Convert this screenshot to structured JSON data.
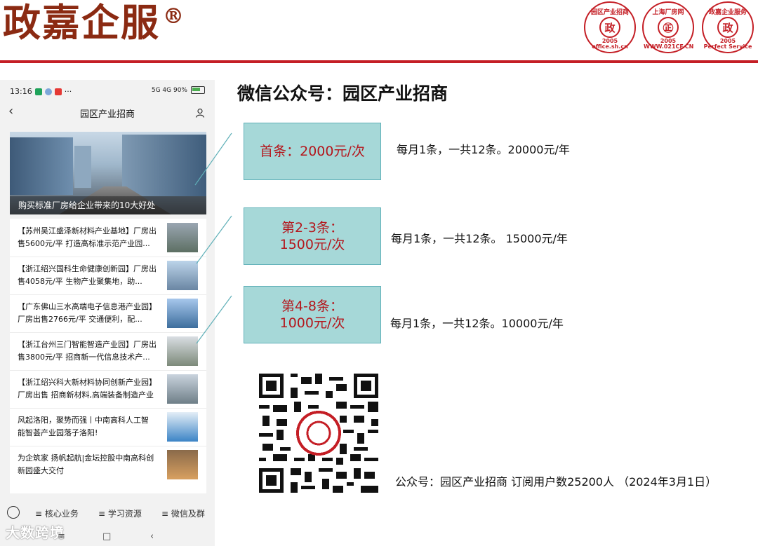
{
  "header": {
    "brand": "政嘉企服",
    "registered": "®",
    "seals": [
      {
        "center": "政",
        "top": "园区产业招商",
        "year": "2005",
        "bottom": "office.sh.cn"
      },
      {
        "center": "㊣",
        "top": "上海厂房网",
        "year": "2005",
        "bottom": "WWW.021CF.CN"
      },
      {
        "center": "政",
        "top": "政嘉企业服务",
        "year": "2005",
        "bottom": "Perfect Service"
      }
    ]
  },
  "phone": {
    "time": "13:16",
    "status_right": "5G 4G 90%",
    "nav_title": "园区产业招商",
    "hero_caption": "购买标准厂房给企业带来的10大好处",
    "articles": [
      {
        "line1": "【苏州吴江盛泽新材料产业基地】厂房出",
        "line2": "售5600元/平 打造高标准示范产业园..."
      },
      {
        "line1": "【浙江绍兴国科生命健康创新园】厂房出",
        "line2": "售4058元/平 生物产业聚集地，助..."
      },
      {
        "line1": "【广东佛山三水高端电子信息港产业园】",
        "line2": "厂房出售2766元/平 交通便利，配..."
      },
      {
        "line1": "【浙江台州三门智能智造产业园】厂房出",
        "line2": "售3800元/平 招商新一代信息技术产..."
      },
      {
        "line1": "【浙江绍兴科大新材料协同创新产业园】",
        "line2": "厂房出售 招商新材料,高端装备制造产业"
      },
      {
        "line1": "风起洛阳，聚势而强丨中南高科人工智",
        "line2": "能智荟产业园落子洛阳!"
      },
      {
        "line1": "为企筑家 扬帆起航|金坛控股中南高科创",
        "line2": "新园盛大交付"
      }
    ],
    "tabs": [
      "核心业务",
      "学习资源",
      "微信及群"
    ],
    "watermark": "大数跨境"
  },
  "panel": {
    "title": "微信公众号：园区产业招商",
    "prices": [
      {
        "label": "首条：2000元/次",
        "note": "每月1条，一共12条。20000元/年"
      },
      {
        "label_line1": "第2-3条：",
        "label_line2": "1500元/次",
        "note": "每月1条，一共12条。 15000元/年"
      },
      {
        "label_line1": "第4-8条：",
        "label_line2": "1000元/次",
        "note": "每月1条，一共12条。10000元/年"
      }
    ],
    "qr_caption": "公众号：园区产业招商 订阅用户数25200人 （2024年3月1日）"
  },
  "colors": {
    "brand": "#8b2a12",
    "rule": "#c41e25",
    "box_fill": "#a6d8d8",
    "box_text": "#b4161c"
  }
}
